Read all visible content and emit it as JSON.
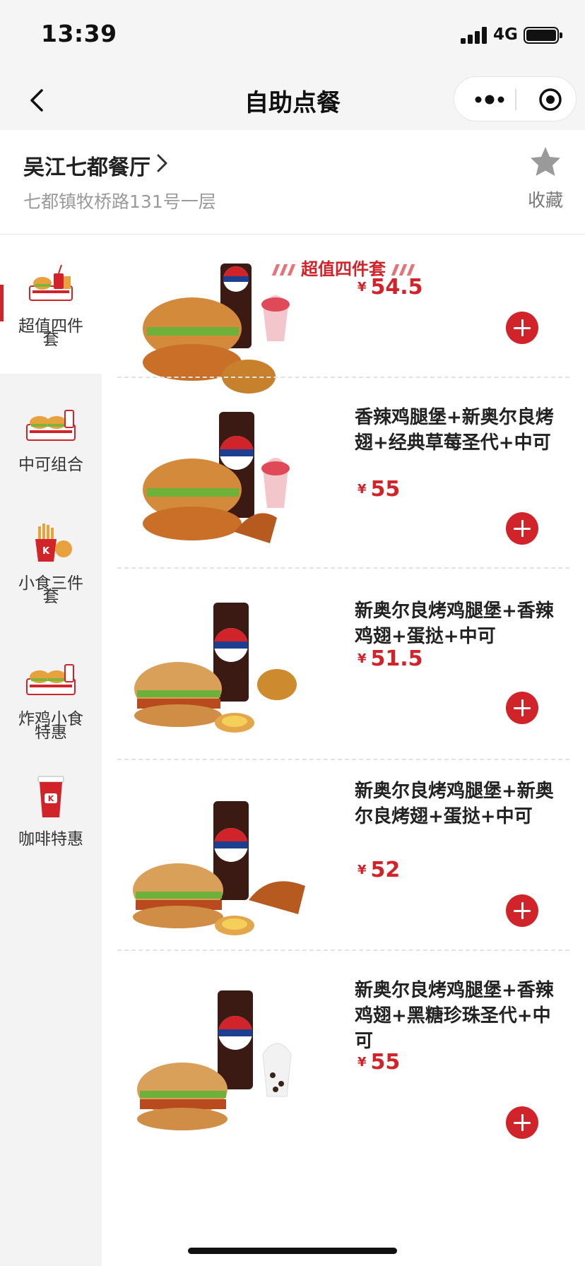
{
  "status_bar": {
    "time": "13:39",
    "network": "4G"
  },
  "nav": {
    "title": "自助点餐",
    "back_icon": "chevron-left-icon",
    "more_icon": "more-dots-icon",
    "capsule_icon": "target-icon"
  },
  "store": {
    "name": "吴江七都餐厅",
    "address": "七都镇",
    "address_rest": "牧桥路131号一层",
    "favorite_label": "收藏"
  },
  "sidebar": {
    "items": [
      {
        "label": "超值四件套",
        "icon": "combo-four-icon",
        "active": true
      },
      {
        "label": "中可组合",
        "icon": "burger-combo-icon",
        "active": false
      },
      {
        "label": "小食三件套",
        "icon": "fries-icon",
        "active": false
      },
      {
        "label": "炸鸡小食特惠",
        "icon": "burger-combo-icon",
        "active": false
      },
      {
        "label": "咖啡特惠",
        "icon": "coffee-cup-icon",
        "active": false
      }
    ]
  },
  "section": {
    "title": "超值四件套"
  },
  "products": [
    {
      "name": "",
      "price": "54.5",
      "currency": "¥"
    },
    {
      "name": "香辣鸡腿堡+新奥尔良烤翅+经典草莓圣代+中可",
      "price": "55",
      "currency": "¥"
    },
    {
      "name": "新奥尔良烤鸡腿堡+香辣鸡翅+蛋挞+中可",
      "price": "51.5",
      "currency": "¥"
    },
    {
      "name": "新奥尔良烤鸡腿堡+新奥尔良烤翅+蛋挞+中可",
      "price": "52",
      "currency": "¥"
    },
    {
      "name": "新奥尔良烤鸡腿堡+香辣鸡翅+黑糖珍珠圣代+中可",
      "price": "55",
      "currency": "¥"
    }
  ],
  "colors": {
    "accent": "#d1232a",
    "sidebar_bg": "#f3f3f3",
    "status_bg": "#f5f5f5"
  }
}
